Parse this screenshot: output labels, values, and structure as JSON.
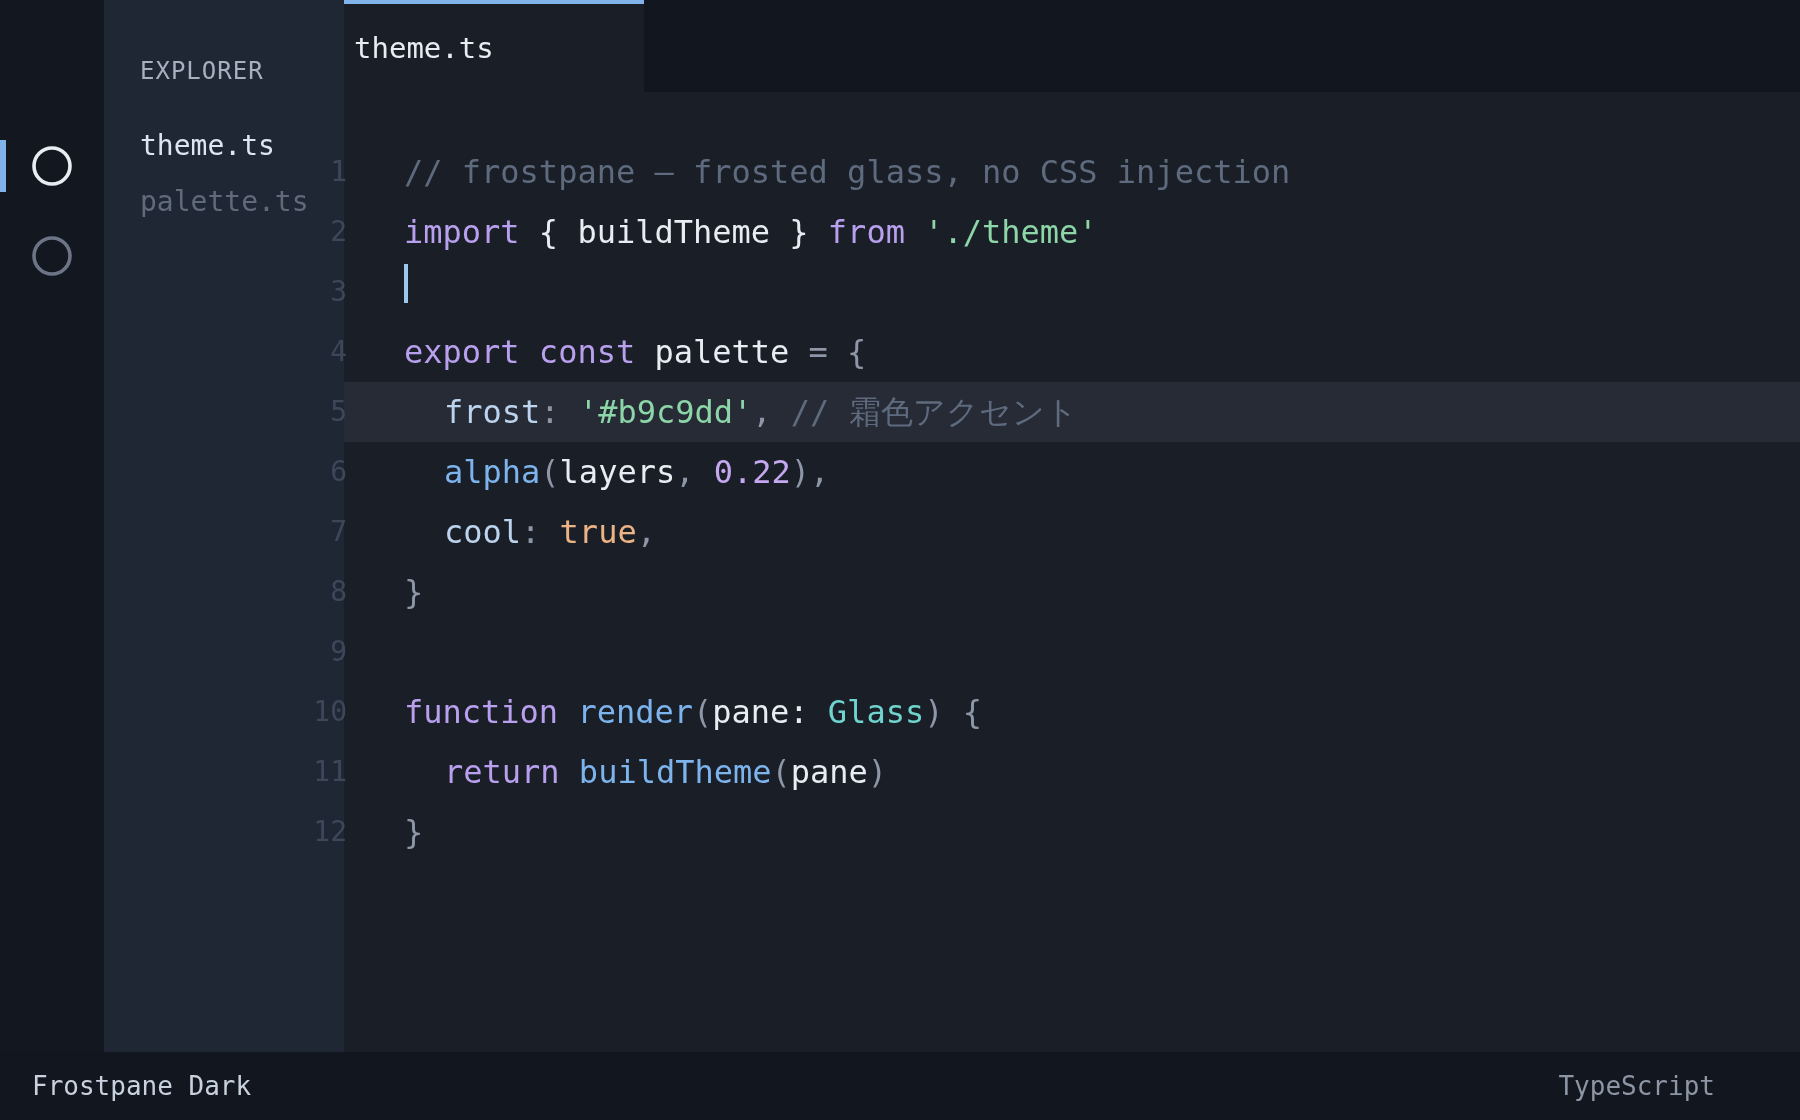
{
  "activity_bar": [
    {
      "selected": true
    },
    {
      "selected": false
    }
  ],
  "explorer": {
    "title": "EXPLORER",
    "files": [
      {
        "name": "theme.ts",
        "selected": true
      },
      {
        "name": "palette.ts",
        "selected": false
      }
    ]
  },
  "tabs": [
    {
      "label": "theme.ts",
      "selected": true
    }
  ],
  "editor": {
    "lines": [
      {
        "number": "1",
        "highlighted": false,
        "cursor": false,
        "indented": false,
        "tokens": [
          {
            "kind": "comment",
            "text": "// frostpane — frosted glass, no CSS injection"
          }
        ]
      },
      {
        "number": "2",
        "highlighted": false,
        "cursor": false,
        "indented": false,
        "tokens": [
          {
            "kind": "keyword",
            "text": "import"
          },
          {
            "kind": "plain",
            "text": " { buildTheme } "
          },
          {
            "kind": "keyword",
            "text": "from "
          },
          {
            "kind": "string",
            "text": "'./theme'"
          }
        ]
      },
      {
        "number": "3",
        "highlighted": false,
        "cursor": true,
        "indented": false
      },
      {
        "number": "4",
        "highlighted": false,
        "cursor": false,
        "indented": false,
        "tokens": [
          {
            "kind": "keyword",
            "text": "export "
          },
          {
            "kind": "keyword",
            "text": "const"
          },
          {
            "kind": "plain",
            "text": " palette "
          },
          {
            "kind": "punct",
            "text": "= {"
          }
        ]
      },
      {
        "number": "5",
        "highlighted": true,
        "cursor": false,
        "indented": true,
        "tokens": [
          {
            "kind": "property",
            "text": "frost"
          },
          {
            "kind": "punct",
            "text": ": "
          },
          {
            "kind": "string",
            "text": "'#b9c9dd'"
          },
          {
            "kind": "punct",
            "text": ", "
          },
          {
            "kind": "comment",
            "text": "// 霜色アクセント"
          }
        ]
      },
      {
        "number": "6",
        "highlighted": false,
        "cursor": false,
        "indented": true,
        "tokens": [
          {
            "kind": "function",
            "text": "alpha"
          },
          {
            "kind": "punct",
            "text": "("
          },
          {
            "kind": "plain",
            "text": "layers"
          },
          {
            "kind": "punct",
            "text": ", "
          },
          {
            "kind": "number",
            "text": "0.22"
          },
          {
            "kind": "punct",
            "text": "),"
          }
        ]
      },
      {
        "number": "7",
        "highlighted": false,
        "cursor": false,
        "indented": true,
        "tokens": [
          {
            "kind": "property",
            "text": "cool"
          },
          {
            "kind": "punct",
            "text": ": "
          },
          {
            "kind": "boolean",
            "text": "true"
          },
          {
            "kind": "punct",
            "text": ","
          }
        ]
      },
      {
        "number": "8",
        "highlighted": false,
        "cursor": false,
        "indented": false,
        "tokens": [
          {
            "kind": "punct",
            "text": "}"
          }
        ]
      },
      {
        "number": "9",
        "highlighted": false,
        "cursor": false
      },
      {
        "number": "10",
        "highlighted": false,
        "cursor": false,
        "indented": false,
        "tokens": [
          {
            "kind": "keyword",
            "text": "function "
          },
          {
            "kind": "function",
            "text": "render"
          },
          {
            "kind": "punct",
            "text": "("
          },
          {
            "kind": "plain",
            "text": "pane: "
          },
          {
            "kind": "type",
            "text": "Glass"
          },
          {
            "kind": "punct",
            "text": ") {"
          }
        ]
      },
      {
        "number": "11",
        "highlighted": false,
        "cursor": false,
        "indented": true,
        "tokens": [
          {
            "kind": "keyword",
            "text": "return "
          },
          {
            "kind": "function",
            "text": "buildTheme"
          },
          {
            "kind": "punct",
            "text": "("
          },
          {
            "kind": "plain",
            "text": "pane"
          },
          {
            "kind": "punct",
            "text": ")"
          }
        ]
      },
      {
        "number": "12",
        "highlighted": false,
        "cursor": false,
        "indented": false,
        "tokens": [
          {
            "kind": "punct",
            "text": "}"
          }
        ]
      }
    ]
  },
  "status_bar": {
    "theme_name": "Frostpane Dark",
    "language": "TypeScript"
  }
}
